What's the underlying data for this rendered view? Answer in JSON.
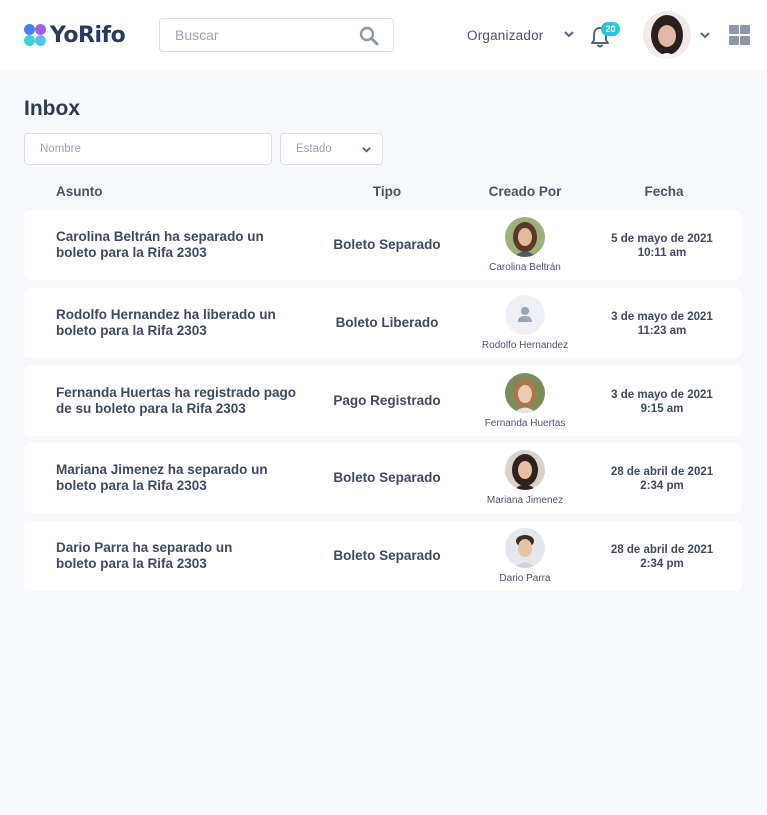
{
  "app": {
    "name": "YoRifo"
  },
  "header": {
    "search_placeholder": "Buscar",
    "role": "Organizador",
    "notifications_count": "20",
    "icons": {
      "search": "search-icon",
      "chevron": "chevron-down-icon",
      "bell": "bell-icon",
      "apps": "apps-grid-icon"
    }
  },
  "page": {
    "title": "Inbox"
  },
  "filters": {
    "name_placeholder": "Nombre",
    "state_label": "Estado"
  },
  "table": {
    "columns": {
      "subject": "Asunto",
      "type": "Tipo",
      "creator": "Creado Por",
      "date": "Fecha"
    },
    "rows": [
      {
        "subject": [
          "Carolina Beltrán ha separado un",
          "boleto para la Rifa 2303"
        ],
        "type": "Boleto Separado",
        "creator": "Carolina Beltrán",
        "date": [
          "5 de mayo de 2021",
          "10:11 am"
        ]
      },
      {
        "subject": [
          "Rodolfo Hernandez ha liberado un",
          "boleto para la Rifa 2303"
        ],
        "type": "Boleto Liberado",
        "creator": "Rodolfo Hernandez",
        "date": [
          "3 de mayo de 2021",
          "11:23 am"
        ]
      },
      {
        "subject": [
          "Fernanda Huertas ha registrado pago",
          "de su boleto para la Rifa 2303"
        ],
        "type": "Pago Registrado",
        "creator": "Fernanda Huertas",
        "date": [
          "3 de mayo de 2021",
          "9:15 am"
        ]
      },
      {
        "subject": [
          "Mariana Jimenez ha separado un",
          "boleto para la Rifa 2303"
        ],
        "type": "Boleto Separado",
        "creator": "Mariana Jimenez",
        "date": [
          "28 de abril de 2021",
          "2:34 pm"
        ]
      },
      {
        "subject": [
          "Dario Parra ha separado un",
          "boleto para la Rifa 2303"
        ],
        "type": "Boleto Separado",
        "creator": "Dario Parra",
        "date": [
          "28 de abril de 2021",
          "2:34 pm"
        ]
      }
    ]
  },
  "colors": {
    "accent": "#28c5d6",
    "background": "#f7f8fc",
    "text": "#3f4a5f"
  }
}
